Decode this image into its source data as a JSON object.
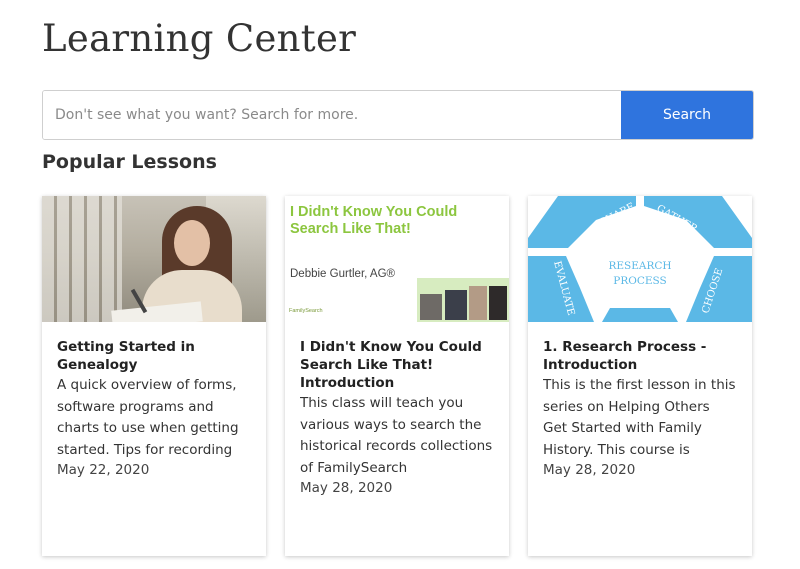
{
  "page": {
    "title": "Learning Center"
  },
  "search": {
    "placeholder": "Don't see what you want? Search for more.",
    "button_label": "Search"
  },
  "popular": {
    "heading": "Popular Lessons",
    "lessons": [
      {
        "title": "Getting Started in Genealogy",
        "description": "A quick overview of forms, software programs and charts to use when getting started. Tips for recording names, dates and things to",
        "date": "May 22, 2020",
        "image": "woman-writing-photo"
      },
      {
        "title": "I Didn't Know You Could Search Like That! Introduction",
        "description": "This class will teach you various ways to search the historical records collections of FamilySearch",
        "date": "May 28, 2020",
        "image": "slide-thumbnail",
        "slide": {
          "title": "I Didn't Know You Could Search Like That!",
          "author": "Debbie Gurtler, AG®",
          "logo": "FamilySearch"
        }
      },
      {
        "title": "1. Research Process - Introduction",
        "description": "This is the first lesson in this series on Helping Others Get Started with Family History. This course is designed for consultants,",
        "date": "May 28, 2020",
        "image": "research-process-diagram",
        "diagram": {
          "center_line1": "RESEARCH",
          "center_line2": "PROCESS",
          "segments": [
            "SHARE",
            "GATHER",
            "EVALUATE",
            "CHOOSE"
          ]
        }
      }
    ]
  },
  "colors": {
    "search_button": "#2f74de",
    "slide_title_green": "#8cc63f",
    "process_blue": "#5bb8e6"
  }
}
